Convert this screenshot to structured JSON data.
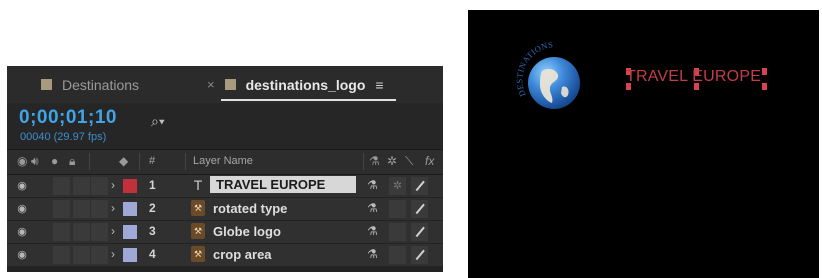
{
  "tabs": [
    {
      "label": "Destinations",
      "active": false
    },
    {
      "label": "destinations_logo",
      "active": true,
      "close": "×",
      "menu": "≡"
    }
  ],
  "timebar": {
    "timecode": "0;00;01;10",
    "frames": "00040 (29.97 fps)",
    "search_icon": "search-icon"
  },
  "columns": {
    "number_symbol": "#",
    "layer_name": "Layer Name"
  },
  "layers": [
    {
      "num": "1",
      "name": "TRAVEL EUROPE",
      "type_glyph": "T",
      "type": "text",
      "color": "#c2313b",
      "selected": true
    },
    {
      "num": "2",
      "name": "rotated type",
      "type_glyph": "⚒",
      "type": "shape",
      "color": "#9fa8d6",
      "selected": false
    },
    {
      "num": "3",
      "name": "Globe logo",
      "type_glyph": "⚒",
      "type": "shape",
      "color": "#9fa8d6",
      "selected": false
    },
    {
      "num": "4",
      "name": "crop area",
      "type_glyph": "⚒",
      "type": "shape",
      "color": "#9fa8d6",
      "selected": false
    }
  ],
  "viewer": {
    "arc_text": "DESTINATIONS",
    "title_text": "TRAVEL EUROPE",
    "title_color": "#c23d4a"
  }
}
